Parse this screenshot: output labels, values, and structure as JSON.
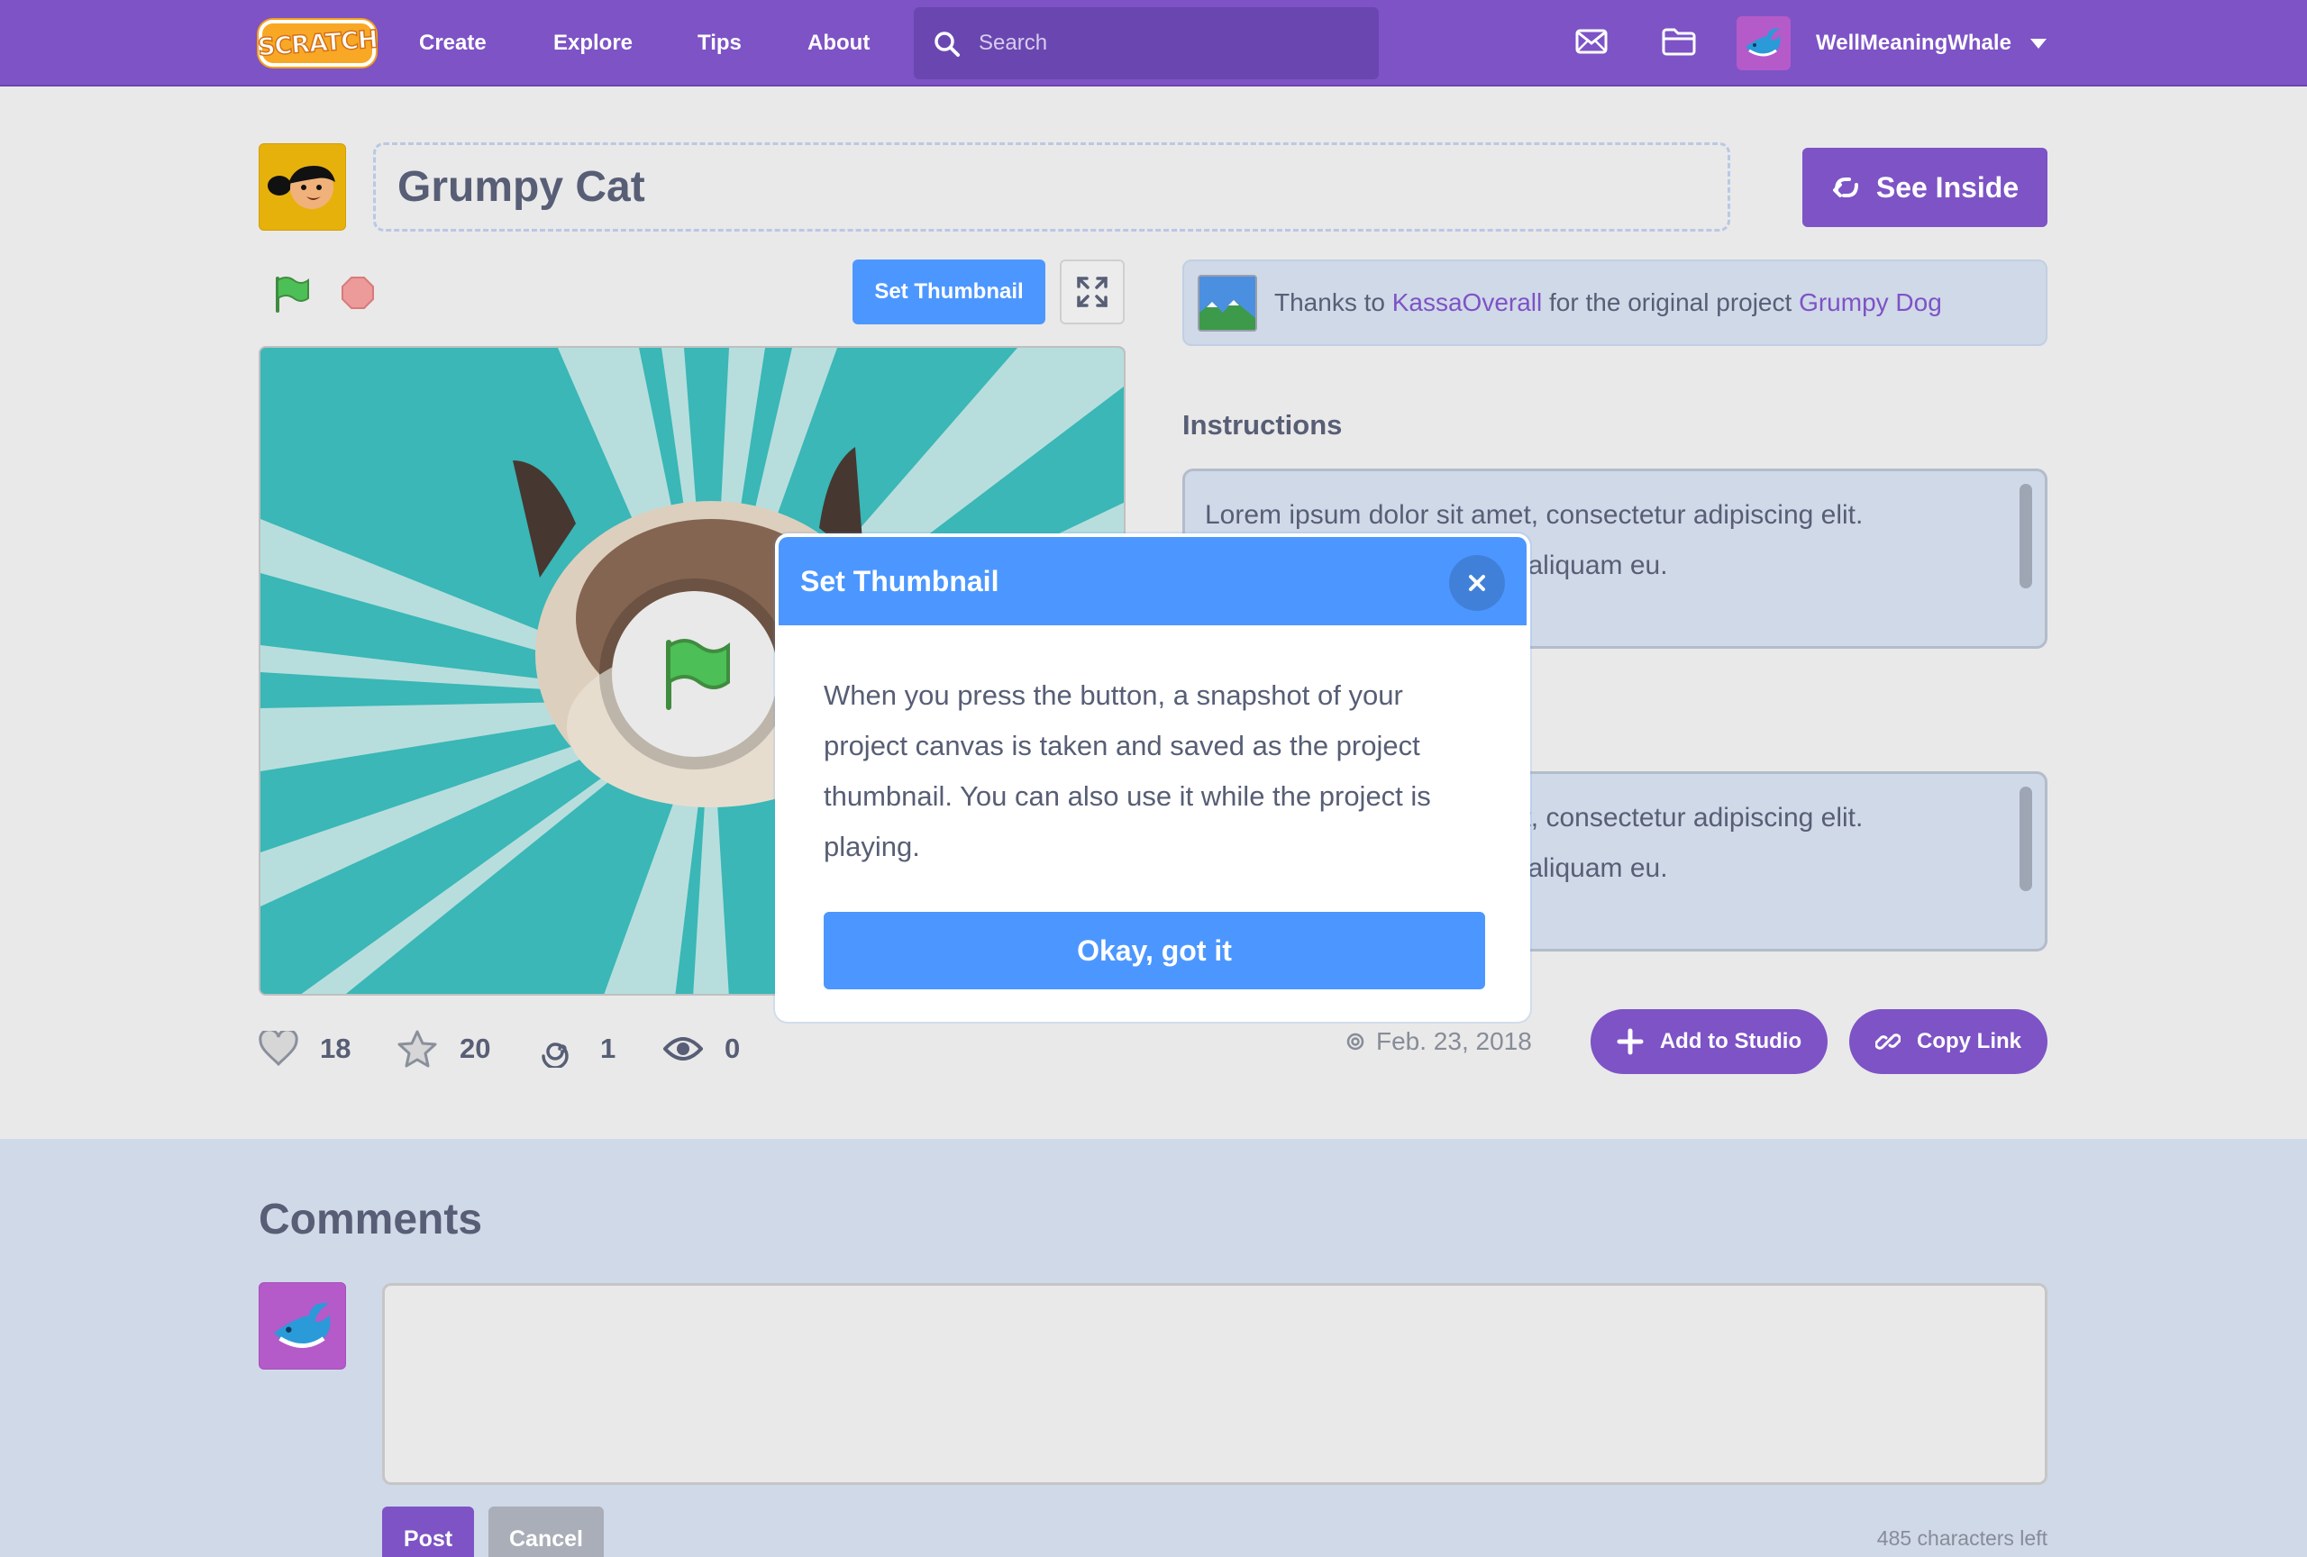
{
  "nav": {
    "logo_text": "SCRATCH",
    "links": [
      "Create",
      "Explore",
      "Tips",
      "About"
    ],
    "search_placeholder": "Search",
    "username": "WellMeaningWhale",
    "icons": [
      "search-icon",
      "messages-icon",
      "my-stuff-icon",
      "account-caret-icon"
    ]
  },
  "project": {
    "title": "Grumpy Cat",
    "see_inside_label": "See Inside",
    "set_thumbnail_label": "Set Thumbnail"
  },
  "stats": {
    "loves": "18",
    "favorites": "20",
    "remixes": "1",
    "views": "0"
  },
  "remix": {
    "prefix": "Thanks to",
    "author": "KassaOverall",
    "middle": "for the original project",
    "original_project": "Grumpy Dog"
  },
  "instructions": {
    "heading": "Instructions",
    "line1": "Lorem ipsum dolor sit amet, consectetur adipiscing elit.",
    "line2": "Nunc, vitae dignissim arcu aliquam eu."
  },
  "notes": {
    "line1": "Lorem ipsum dolor sit amet, consectetur adipiscing elit.",
    "line2": "Nunc, vitae dignissim arcu aliquam eu."
  },
  "meta": {
    "date": "Feb. 23, 2018",
    "add_to_studio_label": "Add to Studio",
    "copy_link_label": "Copy Link"
  },
  "comments": {
    "heading": "Comments",
    "input_value": "",
    "post_label": "Post",
    "cancel_label": "Cancel",
    "chars_left": "485 characters left"
  },
  "modal": {
    "title": "Set Thumbnail",
    "body": "When you press the button, a snapshot of your project canvas is taken and saved as the project thumbnail. You can also use it while the project is playing.",
    "confirm_label": "Okay, got it"
  },
  "colors": {
    "nav_purple": "#7d53c6",
    "accent_blue": "#4c97ff",
    "text": "#575e75",
    "panel_blue": "#d0d9e8",
    "stage_teal": "#3dbfbe"
  }
}
